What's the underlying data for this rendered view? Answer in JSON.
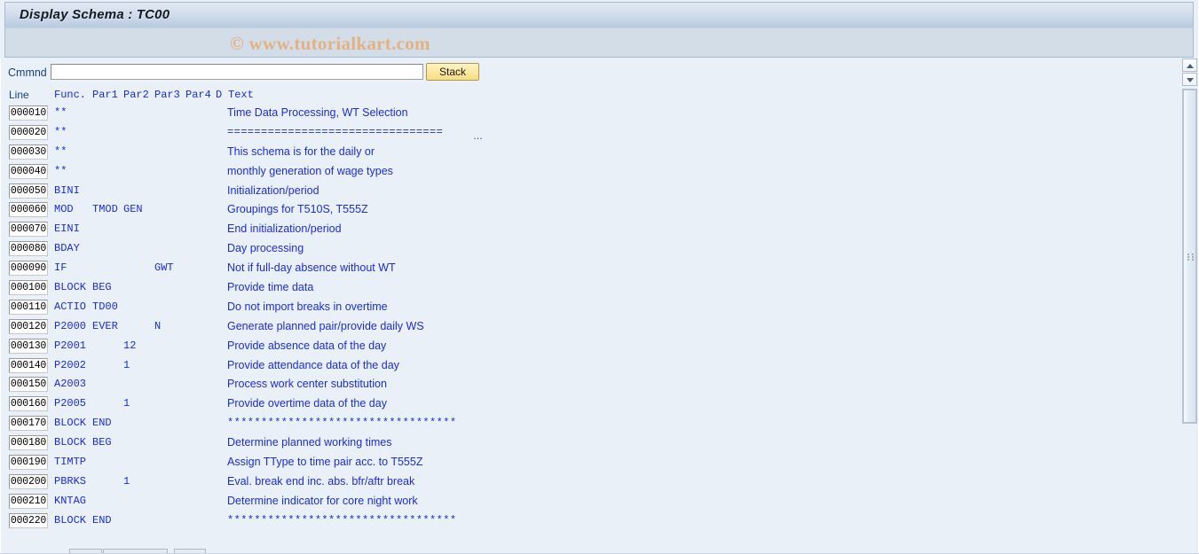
{
  "window": {
    "title": "Display Schema : TC00"
  },
  "watermark": {
    "text": "© www.tutorialkart.com"
  },
  "command_bar": {
    "label": "Cmmnd",
    "input_value": "",
    "input_placeholder": "",
    "stack_label": "Stack"
  },
  "table": {
    "headers": {
      "line": "Line",
      "func": "Func.",
      "par1": "Par1",
      "par2": "Par2",
      "par3": "Par3",
      "par4": "Par4",
      "d": "D",
      "text": "Text"
    },
    "rows": [
      {
        "line": "000010",
        "func": "**",
        "par1": "",
        "par2": "",
        "par3": "",
        "par4": "",
        "d": "",
        "text": "Time Data Processing, WT Selection",
        "symbolic": false,
        "truncated": false
      },
      {
        "line": "000020",
        "func": "**",
        "par1": "",
        "par2": "",
        "par3": "",
        "par4": "",
        "d": "",
        "text": "================================",
        "symbolic": true,
        "truncated": true
      },
      {
        "line": "000030",
        "func": "**",
        "par1": "",
        "par2": "",
        "par3": "",
        "par4": "",
        "d": "",
        "text": "This schema is for the daily or",
        "symbolic": false,
        "truncated": false
      },
      {
        "line": "000040",
        "func": "**",
        "par1": "",
        "par2": "",
        "par3": "",
        "par4": "",
        "d": "",
        "text": "monthly generation of wage types",
        "symbolic": false,
        "truncated": false
      },
      {
        "line": "000050",
        "func": "BINI",
        "par1": "",
        "par2": "",
        "par3": "",
        "par4": "",
        "d": "",
        "text": "Initialization/period",
        "symbolic": false,
        "truncated": false
      },
      {
        "line": "000060",
        "func": "MOD",
        "par1": "TMOD",
        "par2": "GEN",
        "par3": "",
        "par4": "",
        "d": "",
        "text": "Groupings for T510S, T555Z",
        "symbolic": false,
        "truncated": false
      },
      {
        "line": "000070",
        "func": "EINI",
        "par1": "",
        "par2": "",
        "par3": "",
        "par4": "",
        "d": "",
        "text": "End initialization/period",
        "symbolic": false,
        "truncated": false
      },
      {
        "line": "000080",
        "func": "BDAY",
        "par1": "",
        "par2": "",
        "par3": "",
        "par4": "",
        "d": "",
        "text": "Day processing",
        "symbolic": false,
        "truncated": false
      },
      {
        "line": "000090",
        "func": "IF",
        "par1": "",
        "par2": "",
        "par3": "GWT",
        "par4": "",
        "d": "",
        "text": "Not if full-day absence without WT",
        "symbolic": false,
        "truncated": false
      },
      {
        "line": "000100",
        "func": "BLOCK",
        "par1": "BEG",
        "par2": "",
        "par3": "",
        "par4": "",
        "d": "",
        "text": "Provide time data",
        "symbolic": false,
        "truncated": false
      },
      {
        "line": "000110",
        "func": "ACTIO",
        "par1": "TD00",
        "par2": "",
        "par3": "",
        "par4": "",
        "d": "",
        "text": "Do not import breaks in overtime",
        "symbolic": false,
        "truncated": false
      },
      {
        "line": "000120",
        "func": "P2000",
        "par1": "EVER",
        "par2": "",
        "par3": "N",
        "par4": "",
        "d": "",
        "text": "Generate planned pair/provide daily WS",
        "symbolic": false,
        "truncated": false
      },
      {
        "line": "000130",
        "func": "P2001",
        "par1": "",
        "par2": "12",
        "par3": "",
        "par4": "",
        "d": "",
        "text": "Provide absence data of the day",
        "symbolic": false,
        "truncated": false
      },
      {
        "line": "000140",
        "func": "P2002",
        "par1": "",
        "par2": "1",
        "par3": "",
        "par4": "",
        "d": "",
        "text": "Provide attendance data of the day",
        "symbolic": false,
        "truncated": false
      },
      {
        "line": "000150",
        "func": "A2003",
        "par1": "",
        "par2": "",
        "par3": "",
        "par4": "",
        "d": "",
        "text": "Process work center substitution",
        "symbolic": false,
        "truncated": false
      },
      {
        "line": "000160",
        "func": "P2005",
        "par1": "",
        "par2": "1",
        "par3": "",
        "par4": "",
        "d": "",
        "text": "Provide overtime data of the day",
        "symbolic": false,
        "truncated": false
      },
      {
        "line": "000170",
        "func": "BLOCK",
        "par1": "END",
        "par2": "",
        "par3": "",
        "par4": "",
        "d": "",
        "text": "**********************************",
        "symbolic": true,
        "truncated": false
      },
      {
        "line": "000180",
        "func": "BLOCK",
        "par1": "BEG",
        "par2": "",
        "par3": "",
        "par4": "",
        "d": "",
        "text": "Determine planned working times",
        "symbolic": false,
        "truncated": false
      },
      {
        "line": "000190",
        "func": "TIMTP",
        "par1": "",
        "par2": "",
        "par3": "",
        "par4": "",
        "d": "",
        "text": "Assign TType to time pair acc. to T555Z",
        "symbolic": false,
        "truncated": false
      },
      {
        "line": "000200",
        "func": "PBRKS",
        "par1": "",
        "par2": "1",
        "par3": "",
        "par4": "",
        "d": "",
        "text": "Eval. break end inc. abs. bfr/aftr break",
        "symbolic": false,
        "truncated": false
      },
      {
        "line": "000210",
        "func": "KNTAG",
        "par1": "",
        "par2": "",
        "par3": "",
        "par4": "",
        "d": "",
        "text": "Determine indicator for core night work",
        "symbolic": false,
        "truncated": false
      },
      {
        "line": "000220",
        "func": "BLOCK",
        "par1": "END",
        "par2": "",
        "par3": "",
        "par4": "",
        "d": "",
        "text": "**********************************",
        "symbolic": true,
        "truncated": false
      }
    ]
  },
  "scrollbar": {
    "up_icon": "triangle-up-icon",
    "down_icon": "triangle-down-icon",
    "grip_icon": "grip-dots-icon"
  },
  "colors": {
    "title_text": "#11181f",
    "row_text": "#1b2ddb",
    "label_text": "#17427e",
    "watermark": "#e3b184",
    "button_accent": "#f7dd80",
    "page_bg": "#eaf0f7"
  }
}
